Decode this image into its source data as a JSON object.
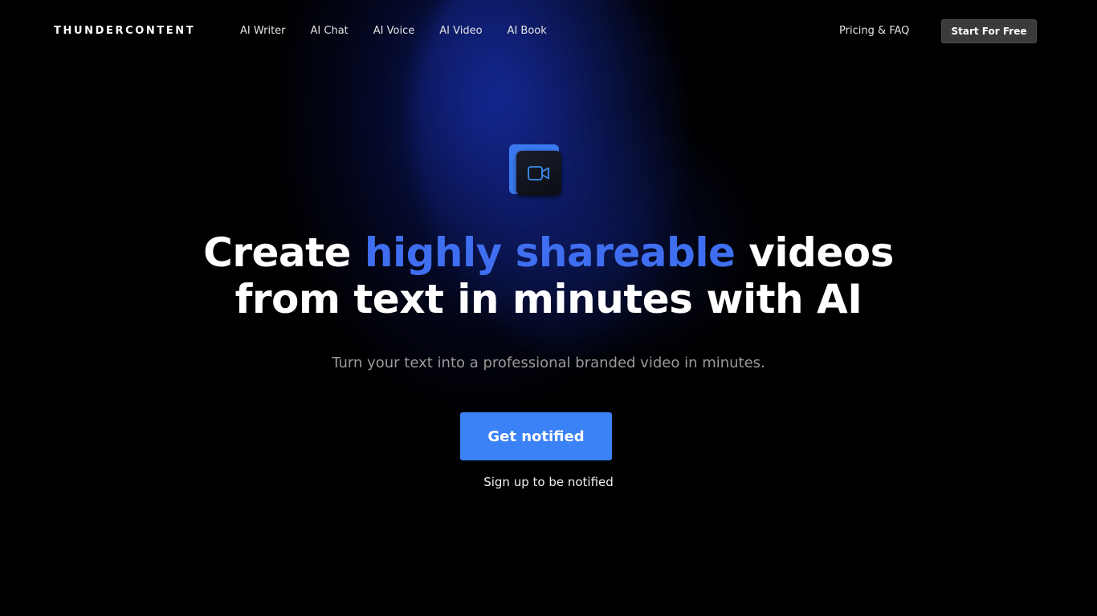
{
  "header": {
    "logo": "THUNDERCONTENT",
    "nav": [
      {
        "label": "AI Writer"
      },
      {
        "label": "AI Chat"
      },
      {
        "label": "AI Voice"
      },
      {
        "label": "AI Video"
      },
      {
        "label": "AI Book"
      }
    ],
    "pricing_label": "Pricing & FAQ",
    "start_label": "Start For Free"
  },
  "hero": {
    "icon": "video-camera-icon",
    "headline_part1": "Create ",
    "headline_accent": "highly shareable",
    "headline_part2": " videos",
    "headline_line2": "from text in minutes with AI",
    "subtitle": "Turn your text into a professional branded video in minutes.",
    "cta_label": "Get notified",
    "cta_note": "Sign up to be notified"
  },
  "colors": {
    "accent": "#3f6ff0",
    "button": "#3b82f6",
    "background": "#000000"
  }
}
